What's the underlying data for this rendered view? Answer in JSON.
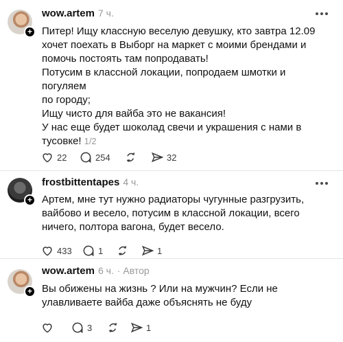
{
  "posts": [
    {
      "username": "wow.artem",
      "time": "7 ч.",
      "author_tag": "",
      "lines": [
        "Питер! Ищу классную веселую девушку, кто завтра 12.09",
        "хочет поехать в Выборг на маркет с моими брендами и",
        "помочь постоять там попродавать!",
        "Потусим в классной локации, попродаем шмотки и погуляем",
        "по городу;",
        "Ищу чисто для вайба это не вакансия!",
        "У нас еще будет шоколад свечи и украшения с нами в",
        "тусовке!"
      ],
      "pager": "1/2",
      "likes": "22",
      "comments": "254",
      "reposts": "",
      "shares": "32"
    },
    {
      "username": "frostbittentapes",
      "time": "4 ч.",
      "author_tag": "",
      "lines": [
        "Артем, мне тут нужно радиаторы чугунные разгрузить,",
        "вайбово и весело, потусим в классной локации, всего",
        "ничего, полтора вагона, будет весело."
      ],
      "likes": "433",
      "comments": "1",
      "reposts": "",
      "shares": "1"
    },
    {
      "username": "wow.artem",
      "time": "6 ч.",
      "author_tag": "· Автор",
      "lines": [
        "Вы обижены на жизнь ? Или на мужчин? Если не",
        "улавливаете вайба даже объяснять не буду"
      ],
      "likes": "",
      "comments": "3",
      "reposts": "",
      "shares": "1"
    }
  ],
  "icons": {
    "like": "heart-icon",
    "comment": "comment-bubble-icon",
    "repost": "repost-arrows-icon",
    "share": "send-icon",
    "more": "more-dots-icon",
    "follow": "plus-icon"
  }
}
